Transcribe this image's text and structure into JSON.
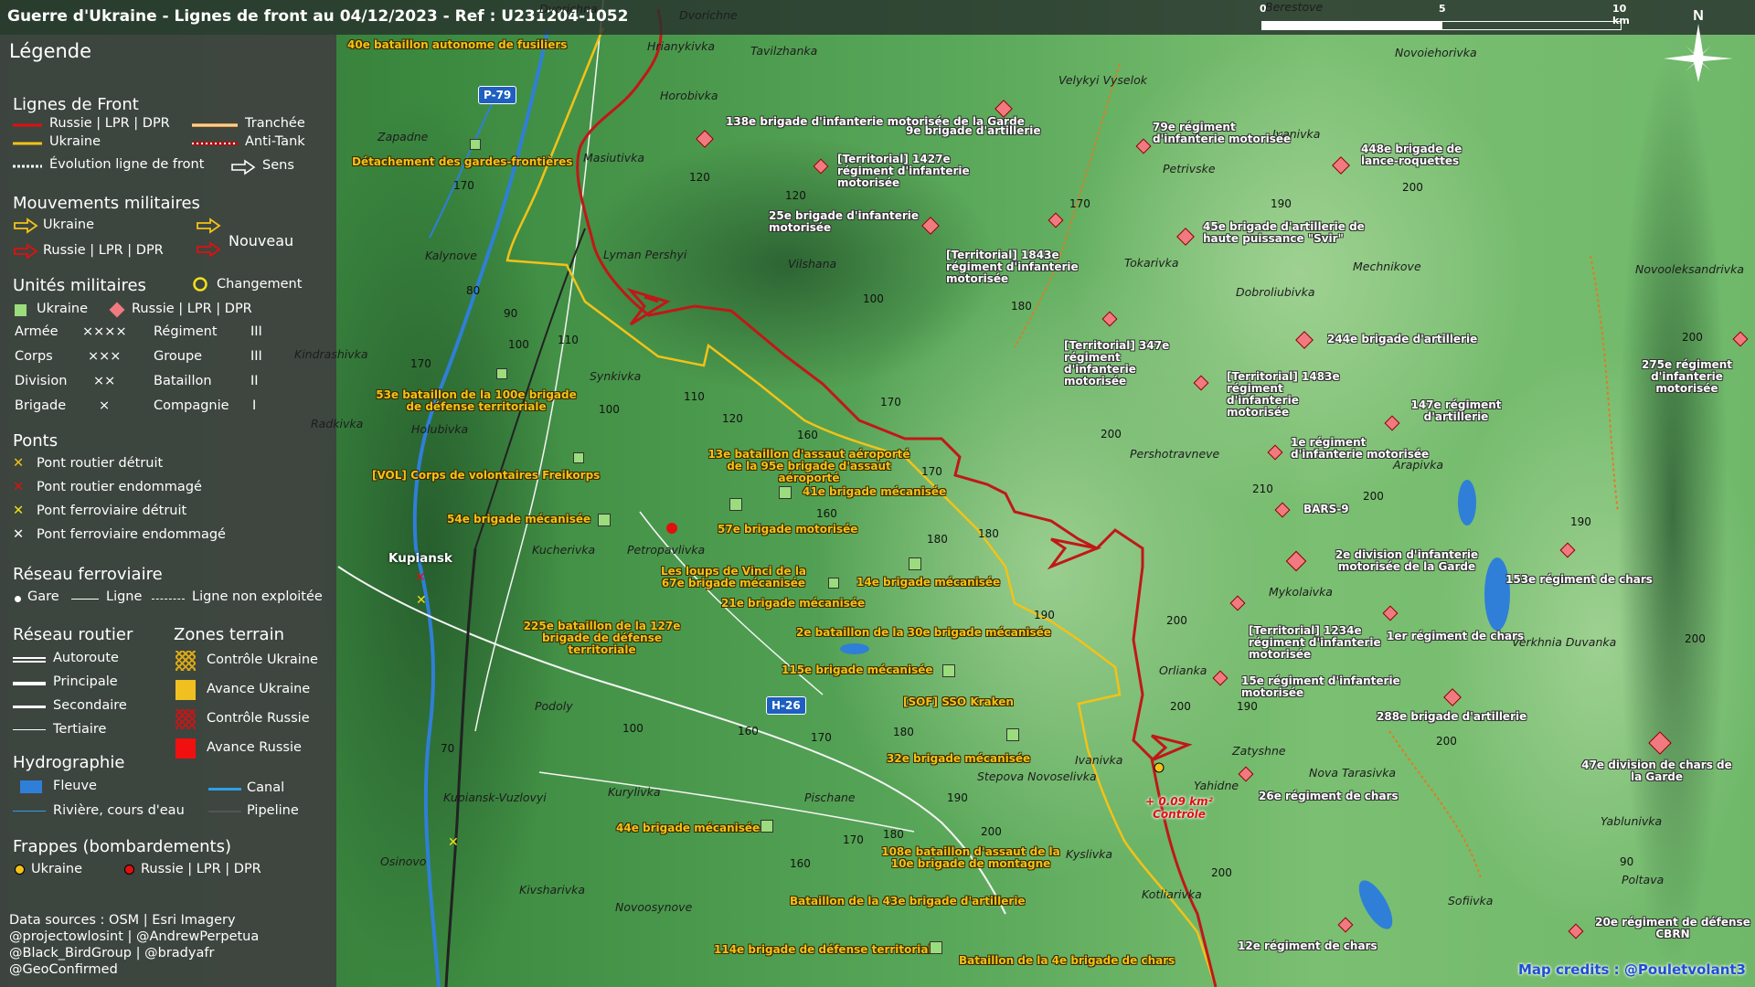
{
  "title": "Guerre d'Ukraine - Lignes de front au 04/12/2023 - Ref : U231204-1052",
  "scale": {
    "l0": "0",
    "l5": "5",
    "l10": "10 km"
  },
  "north": "N",
  "legend": {
    "heading": "Légende",
    "front_title": "Lignes de Front",
    "front_ru": "Russie | LPR | DPR",
    "front_ua": "Ukraine",
    "front_evo": "Évolution ligne de front",
    "front_trench": "Tranchée",
    "front_antitank": "Anti-Tank",
    "front_sens": "Sens",
    "mov_title": "Mouvements militaires",
    "mov_ua": "Ukraine",
    "mov_ru": "Russie | LPR | DPR",
    "mov_new": "Nouveau",
    "units_title": "Unités militaires",
    "units_change": "Changement",
    "units_ua": "Ukraine",
    "units_ru": "Russie | LPR | DPR",
    "ech": [
      {
        "name": "Armée",
        "sym": "××××"
      },
      {
        "name": "Corps",
        "sym": "×××"
      },
      {
        "name": "Division",
        "sym": "××"
      },
      {
        "name": "Brigade",
        "sym": "×"
      },
      {
        "name": "Régiment",
        "sym": "III"
      },
      {
        "name": "Groupe",
        "sym": "III"
      },
      {
        "name": "Bataillon",
        "sym": "II"
      },
      {
        "name": "Compagnie",
        "sym": "I"
      }
    ],
    "bridges_title": "Ponts",
    "bridges": [
      "Pont routier détruit",
      "Pont routier endommagé",
      "Pont ferroviaire détruit",
      "Pont ferroviaire endommagé"
    ],
    "rail_title": "Réseau ferroviaire",
    "rail_gare": "Gare",
    "rail_ligne": "Ligne",
    "rail_non": "Ligne non exploitée",
    "road_title": "Réseau routier",
    "roads": [
      "Autoroute",
      "Principale",
      "Secondaire",
      "Tertiaire"
    ],
    "zones_title": "Zones terrain",
    "zones": [
      "Contrôle Ukraine",
      "Avance Ukraine",
      "Contrôle Russie",
      "Avance Russie"
    ],
    "hydro_title": "Hydrographie",
    "hydro": [
      "Fleuve",
      "Canal",
      "Rivière, cours d'eau",
      "Pipeline"
    ],
    "strikes_title": "Frappes (bombardements)",
    "strikes_ua": "Ukraine",
    "strikes_ru": "Russie | LPR | DPR",
    "sources": [
      "Data sources : OSM | Esri Imagery",
      "@projectowlosint | @AndrewPerpetua",
      "@Black_BirdGroup | @bradyafr",
      "@GeoConfirmed"
    ]
  },
  "map_credit": "Map credits : @Pouletvolant3",
  "roads": {
    "p79": "P-79",
    "h26": "H-26"
  },
  "places": [
    {
      "n": "Dvorichna"
    },
    {
      "n": "Dvorichne"
    },
    {
      "n": "Berestove"
    },
    {
      "n": "Hrianykivka"
    },
    {
      "n": "Tavilzhanka"
    },
    {
      "n": "Novoiehorivka"
    },
    {
      "n": "Horobivka"
    },
    {
      "n": "Velykyi Vyselok"
    },
    {
      "n": "Zapadne"
    },
    {
      "n": "Masiutivka"
    },
    {
      "n": "Ivanivka"
    },
    {
      "n": "Petrivske"
    },
    {
      "n": "Kalynove"
    },
    {
      "n": "Lyman Pershyi"
    },
    {
      "n": "Vilshana"
    },
    {
      "n": "Tokarivka"
    },
    {
      "n": "Mechnikove"
    },
    {
      "n": "Novooleksandrivka"
    },
    {
      "n": "Dobroliubivka"
    },
    {
      "n": "Kindrashivka"
    },
    {
      "n": "Synkivka"
    },
    {
      "n": "Radkivka"
    },
    {
      "n": "Holubivka"
    },
    {
      "n": "Pershotravneve"
    },
    {
      "n": "Arapivka"
    },
    {
      "n": "Kupiansk"
    },
    {
      "n": "Kucherivka"
    },
    {
      "n": "Petropavlivka"
    },
    {
      "n": "Mykolaivka"
    },
    {
      "n": "Orlianka"
    },
    {
      "n": "Verkhnia Duvanka"
    },
    {
      "n": "Podoly"
    },
    {
      "n": "Ivanivka"
    },
    {
      "n": "Stepova Novoselivka"
    },
    {
      "n": "Zatyshne"
    },
    {
      "n": "Yahidne"
    },
    {
      "n": "Nova Tarasivka"
    },
    {
      "n": "Kupiansk-Vuzlovyi"
    },
    {
      "n": "Kurylivka"
    },
    {
      "n": "Pischane"
    },
    {
      "n": "Yablunivka"
    },
    {
      "n": "Osinovo"
    },
    {
      "n": "Kyslivka"
    },
    {
      "n": "Kivsharivka"
    },
    {
      "n": "Kotliarivka"
    },
    {
      "n": "Novoosynove"
    },
    {
      "n": "Sofiivka"
    },
    {
      "n": "Poltava"
    }
  ],
  "units_ua": [
    "40e bataillon autonome de fusiliers",
    "Détachement des gardes-frontières",
    "53e bataillon de la 100e brigade de défense territoriale",
    "[VOL] Corps de volontaires Freikorps",
    "54e brigade mécanisée",
    "13e bataillon d'assaut aéroporté de la 95e brigade d'assaut aéroporté",
    "41e brigade mécanisée",
    "57e brigade motorisée",
    "Les loups de Vinci de la 67e brigade mécanisée",
    "14e brigade mécanisée",
    "21e brigade mécanisée",
    "225e bataillon de la 127e brigade de défense territoriale",
    "2e bataillon de la 30e brigade mécanisée",
    "115e brigade mécanisée",
    "[SOF] SSO Kraken",
    "32e brigade mécanisée",
    "44e brigade mécanisée",
    "108e bataillon d'assaut de la 10e brigade de montagne",
    "Bataillon de la 43e brigade d'artillerie",
    "114e brigade de défense territoriale",
    "Bataillon de la 4e brigade de chars"
  ],
  "units_ru": [
    "138e brigade d'infanterie motorisée de la Garde",
    "9e brigade d'artillerie",
    "79e régiment d'infanterie motorisée",
    "448e brigade de lance-roquettes",
    "[Territorial] 1427e régiment d'infanterie motorisée",
    "25e brigade d'infanterie motorisée",
    "45e brigade d'artillerie de haute puissance \"Svir\"",
    "[Territorial] 1843e régiment d'infanterie motorisée",
    "244e brigade d'artillerie",
    "[Territorial] 347e régiment d'infanterie motorisée",
    "[Territorial] 1483e régiment d'infanterie motorisée",
    "275e régiment d'infanterie motorisée",
    "147e régiment d'artillerie",
    "1e régiment d'infanterie motorisée",
    "BARS-9",
    "2e division d'infanterie motorisée de la Garde",
    "153e régiment de chars",
    "[Territorial] 1234e régiment d'infanterie motorisée",
    "1er régiment de chars",
    "15e régiment d'infanterie motorisée",
    "288e brigade d'artillerie",
    "26e régiment de chars",
    "47e division de chars de la Garde",
    "12e régiment de chars",
    "20e régiment de défense CBRN"
  ],
  "control_note": "+ 0.09 km² Contrôle",
  "elevations": [
    "170",
    "120",
    "120",
    "170",
    "190",
    "200",
    "80",
    "90",
    "100",
    "110",
    "170",
    "100",
    "110",
    "100",
    "120",
    "160",
    "180",
    "170",
    "160",
    "180",
    "170",
    "200",
    "190",
    "200",
    "210",
    "200",
    "190",
    "200",
    "180",
    "100",
    "160",
    "170",
    "180",
    "190",
    "200",
    "170",
    "180",
    "160",
    "70",
    "200",
    "200",
    "190",
    "200",
    "200",
    "90"
  ]
}
